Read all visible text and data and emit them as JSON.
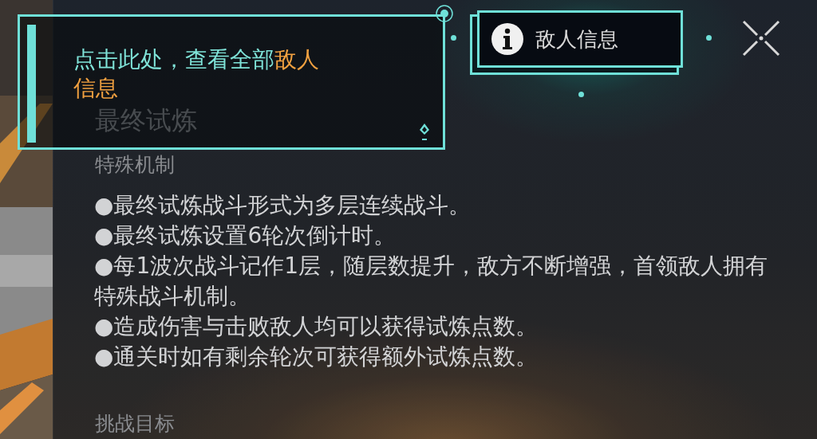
{
  "tooltip": {
    "segments": [
      {
        "text": "点击此处，查看全部",
        "highlight": false
      },
      {
        "text": "敌人信息",
        "highlight": true
      }
    ]
  },
  "enemy_info_button": {
    "label": "敌人信息"
  },
  "title": "最终试炼",
  "sections": [
    {
      "heading": "特殊机制",
      "items": [
        "●最终试炼战斗形式为多层连续战斗。",
        "●最终试炼设置6轮次倒计时。",
        "●每1波次战斗记作1层，随层数提升，敌方不断增强，首领敌人拥有特殊战斗机制。",
        "●造成伤害与击败敌人均可以获得试炼点数。",
        "●通关时如有剩余轮次可获得额外试炼点数。"
      ]
    },
    {
      "heading": "挑战目标"
    }
  ]
}
